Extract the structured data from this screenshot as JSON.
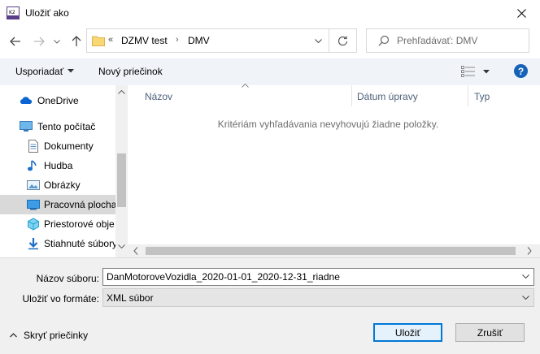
{
  "window": {
    "title": "Uložiť ako",
    "app_icon": "app-icon"
  },
  "nav": {
    "back_icon": "arrow-left-icon",
    "forward_icon": "arrow-right-icon",
    "recent_icon": "chevron-down-icon",
    "up_icon": "arrow-up-icon"
  },
  "address": {
    "overflow": "«",
    "crumbs": [
      "DZMV test",
      "DMV"
    ],
    "separator": "›"
  },
  "search": {
    "placeholder": "Prehľadávať: DMV"
  },
  "toolbar": {
    "organize_label": "Usporiadať",
    "new_folder_label": "Nový priečinok",
    "help_label": "?"
  },
  "sidebar": {
    "items": [
      {
        "label": "OneDrive",
        "icon": "onedrive-icon"
      },
      {
        "label": "Tento počítač",
        "icon": "computer-icon"
      },
      {
        "label": "Dokumenty",
        "icon": "documents-icon"
      },
      {
        "label": "Hudba",
        "icon": "music-icon"
      },
      {
        "label": "Obrázky",
        "icon": "pictures-icon"
      },
      {
        "label": "Pracovná plocha",
        "icon": "desktop-icon",
        "selected": true
      },
      {
        "label": "Priestorové obje",
        "icon": "3d-objects-icon"
      },
      {
        "label": "Stiahnuté súbory",
        "icon": "downloads-icon"
      }
    ]
  },
  "content": {
    "columns": [
      "Názov",
      "Dátum úpravy",
      "Typ"
    ],
    "empty_message": "Kritériám vyhľadávania nevyhovujú žiadne položky."
  },
  "form": {
    "file_name_label": "Názov súboru:",
    "file_name_value": "DanMotoroveVozidla_2020-01-01_2020-12-31_riadne",
    "file_type_label": "Uložiť vo formáte:",
    "file_type_value": "XML súbor"
  },
  "footer": {
    "hide_folders_label": "Skryť priečinky",
    "save_label": "Uložiť",
    "cancel_label": "Zrušiť"
  },
  "colors": {
    "accent": "#0078d7",
    "help": "#1762b9",
    "selected": "#d9d9d9",
    "toolbar_bg": "#f0f4f9"
  }
}
